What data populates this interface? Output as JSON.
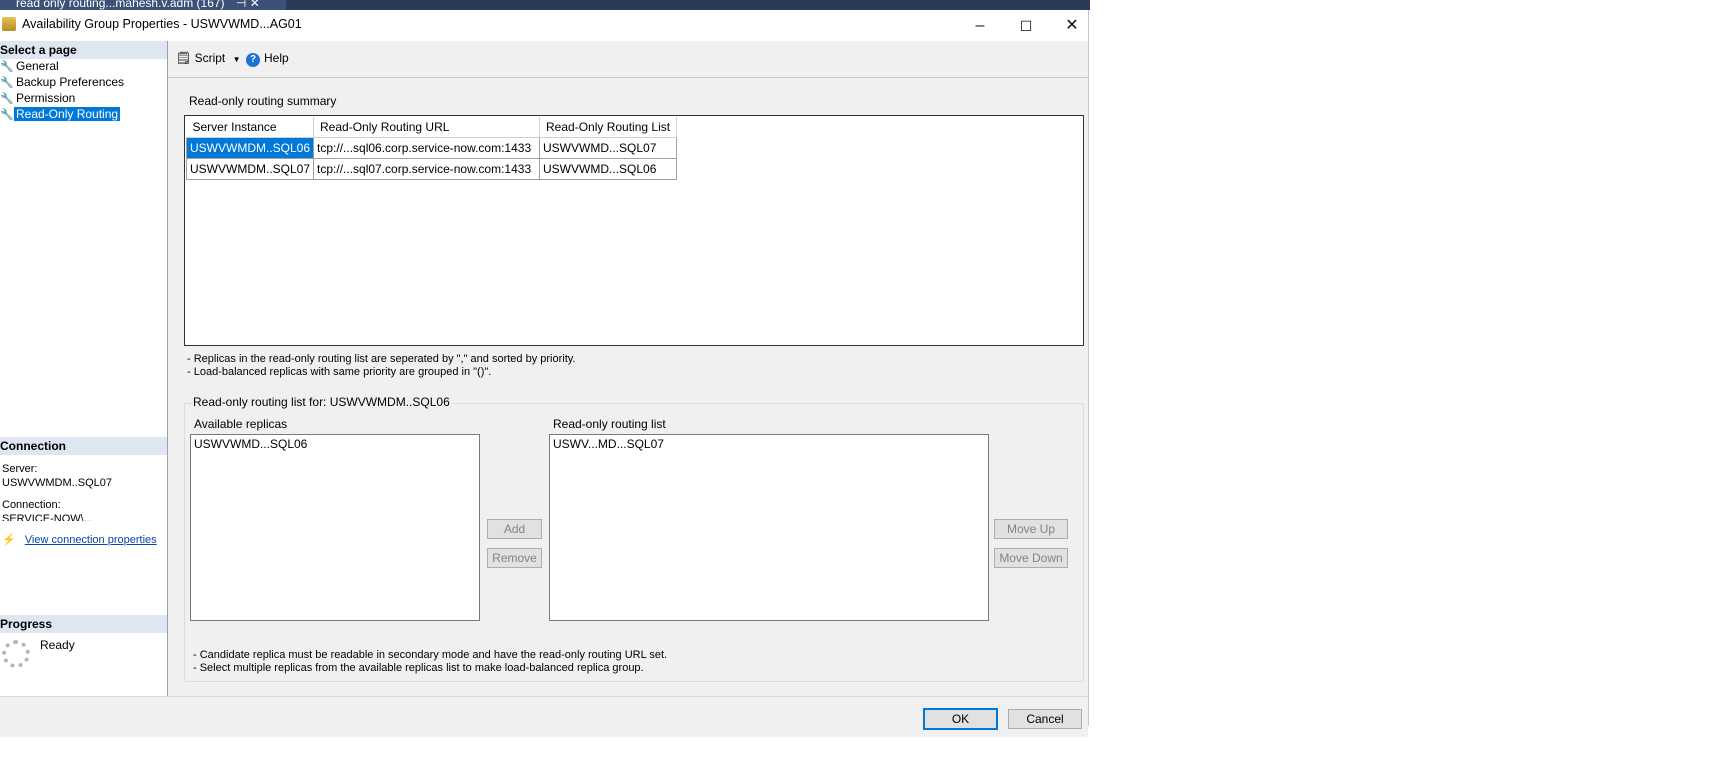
{
  "taskbar": {
    "tab_label": "read only routing...mahesh.v.adm (167)",
    "pin": "⊣",
    "close": "✕"
  },
  "window": {
    "title": "Availability Group Properties - USWVWMD...AG01",
    "minimize": "–",
    "maximize": "☐",
    "close": "✕"
  },
  "left_pane": {
    "select_page_heading": "Select a page",
    "pages": [
      {
        "label": "General",
        "selected": false
      },
      {
        "label": "Backup Preferences",
        "selected": false
      },
      {
        "label": "Permission",
        "selected": false
      },
      {
        "label": "Read-Only Routing",
        "selected": true
      }
    ],
    "connection_heading": "Connection",
    "server_label": "Server:",
    "server_value": "USWVWMDM..SQL07",
    "connection_label": "Connection:",
    "connection_value": "SERVICE-NOW\\...",
    "view_connection_properties": "View connection properties",
    "progress_heading": "Progress",
    "progress_status": "Ready"
  },
  "toolbar": {
    "script_label": "Script",
    "script_dropdown": "▼",
    "help_label": "Help"
  },
  "summary": {
    "heading": "Read-only routing summary",
    "columns": [
      "Server Instance",
      "Read-Only Routing URL",
      "Read-Only Routing List"
    ],
    "rows": [
      [
        "USWVWMDM..SQL06",
        "tcp://...sql06.corp.service-now.com:1433",
        "USWVWMD...SQL07"
      ],
      [
        "USWVWMDM..SQL07",
        "tcp://...sql07.corp.service-now.com:1433",
        "USWVWMD...SQL06"
      ]
    ],
    "notes": [
      "- Replicas in the read-only routing list are seperated by \",\" and sorted by priority.",
      "- Load-balanced replicas with same priority are grouped in \"()\"."
    ]
  },
  "routing_list": {
    "heading": "Read-only routing list for: USWVWMDM..SQL06",
    "available_label": "Available replicas",
    "available_items": [
      "USWVWMD...SQL06"
    ],
    "routing_label": "Read-only routing list",
    "routing_items": [
      "USWV...MD...SQL07"
    ],
    "add_label": "Add",
    "remove_label": "Remove",
    "move_up_label": "Move Up",
    "move_down_label": "Move Down",
    "notes": [
      "- Candidate replica must be readable in secondary mode and have the read-only routing URL set.",
      "- Select multiple replicas from the available replicas list to make load-balanced replica group."
    ]
  },
  "buttons": {
    "ok": "OK",
    "cancel": "Cancel"
  }
}
